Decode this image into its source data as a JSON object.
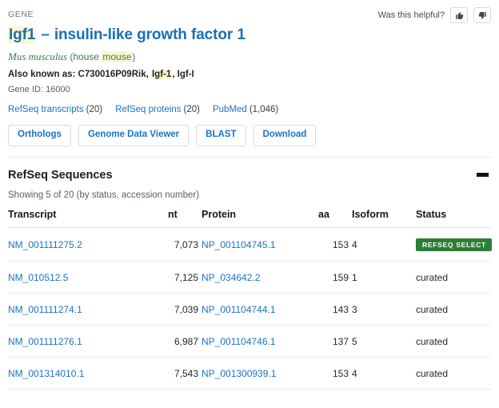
{
  "header": {
    "kicker": "GENE",
    "helpful_label": "Was this helpful?",
    "thumbs_up_icon": "thumbs-up-icon",
    "thumbs_down_icon": "thumbs-down-icon",
    "gene_symbol": "Igf1",
    "dash": "–",
    "gene_name": "insulin-like growth factor 1",
    "species_scientific": "Mus musculus",
    "species_common_prefix": " (house ",
    "species_common_highlight": "mouse",
    "species_common_suffix": ")",
    "aka_label": "Also known as: ",
    "aka_before": "C730016P09Rik, ",
    "aka_highlight": "Igf-1",
    "aka_after": ", Igf-I",
    "gene_id": "Gene ID: 16000"
  },
  "links": [
    {
      "label": "RefSeq transcripts",
      "count": "(20)"
    },
    {
      "label": "RefSeq proteins",
      "count": "(20)"
    },
    {
      "label": "PubMed",
      "count": "(1,046)"
    }
  ],
  "buttons": [
    {
      "label": "Orthologs"
    },
    {
      "label": "Genome Data Viewer"
    },
    {
      "label": "BLAST"
    },
    {
      "label": "Download"
    }
  ],
  "section": {
    "title": "RefSeq Sequences",
    "collapse_icon": "minus-icon",
    "showing": "Showing 5 of 20 (by status, accession number)",
    "columns": [
      "Transcript",
      "nt",
      "Protein",
      "aa",
      "Isoform",
      "Status"
    ],
    "rows": [
      {
        "transcript": "NM_001111275.2",
        "nt": "7,073",
        "protein": "NP_001104745.1",
        "aa": "153",
        "isoform": "4",
        "status": "REFSEQ SELECT",
        "status_type": "badge"
      },
      {
        "transcript": "NM_010512.5",
        "nt": "7,125",
        "protein": "NP_034642.2",
        "aa": "159",
        "isoform": "1",
        "status": "curated",
        "status_type": "plain"
      },
      {
        "transcript": "NM_001111274.1",
        "nt": "7,039",
        "protein": "NP_001104744.1",
        "aa": "143",
        "isoform": "3",
        "status": "curated",
        "status_type": "plain"
      },
      {
        "transcript": "NM_001111276.1",
        "nt": "6,987",
        "protein": "NP_001104746.1",
        "aa": "137",
        "isoform": "5",
        "status": "curated",
        "status_type": "plain"
      },
      {
        "transcript": "NM_001314010.1",
        "nt": "7,543",
        "protein": "NP_001300939.1",
        "aa": "153",
        "isoform": "4",
        "status": "curated",
        "status_type": "plain"
      }
    ]
  },
  "colors": {
    "link_blue": "#1a73c8",
    "title_blue": "#1a6fb5",
    "species_green": "#3c7d4b",
    "badge_green": "#2d7d36",
    "highlight_yellow": "#fbf6cf"
  }
}
